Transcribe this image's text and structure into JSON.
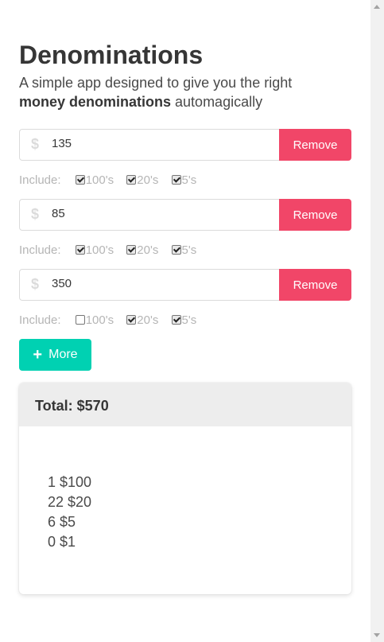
{
  "header": {
    "title": "Denominations",
    "subtitle_pre": "A simple app designed to give you the right ",
    "subtitle_bold": "money denominations",
    "subtitle_post": " automagically"
  },
  "icons": {
    "dollar": "dollar-sign-icon",
    "plus": "plus-icon"
  },
  "colors": {
    "remove": "#f14668",
    "more": "#00d1b2"
  },
  "include_label": "Include:",
  "rows": [
    {
      "amount": "135",
      "remove_label": "Remove",
      "options": [
        {
          "label": "100's",
          "checked": true
        },
        {
          "label": "20's",
          "checked": true
        },
        {
          "label": "5's",
          "checked": true
        }
      ]
    },
    {
      "amount": "85",
      "remove_label": "Remove",
      "options": [
        {
          "label": "100's",
          "checked": true
        },
        {
          "label": "20's",
          "checked": true
        },
        {
          "label": "5's",
          "checked": true
        }
      ]
    },
    {
      "amount": "350",
      "remove_label": "Remove",
      "options": [
        {
          "label": "100's",
          "checked": false
        },
        {
          "label": "20's",
          "checked": true
        },
        {
          "label": "5's",
          "checked": true
        }
      ]
    }
  ],
  "more_label": "More",
  "total": {
    "label": "Total: $570",
    "lines": [
      "1 $100",
      "22 $20",
      "6 $5",
      "0 $1"
    ]
  }
}
